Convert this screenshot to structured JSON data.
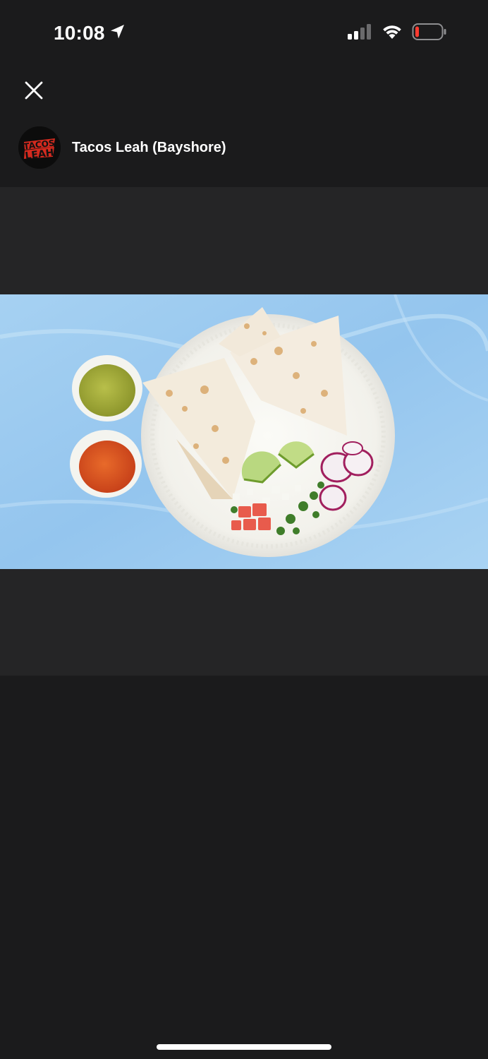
{
  "status_bar": {
    "time": "10:08",
    "location_icon": "location-arrow-icon",
    "signal_icon": "cellular-signal-icon",
    "wifi_icon": "wifi-icon",
    "battery_icon": "battery-low-icon",
    "battery_color": "#ff3b30"
  },
  "header": {
    "close_icon": "close-icon",
    "store_name": "Tacos Leah (Bayshore)",
    "logo_text": "TACOS LEAH"
  },
  "media": {
    "photo_icon": "quesadilla-plate-photo"
  },
  "colors": {
    "background": "#1b1b1c",
    "media_background": "#252526",
    "photo_backdrop": "#9cc9ef",
    "logo_red": "#d42a1f"
  }
}
